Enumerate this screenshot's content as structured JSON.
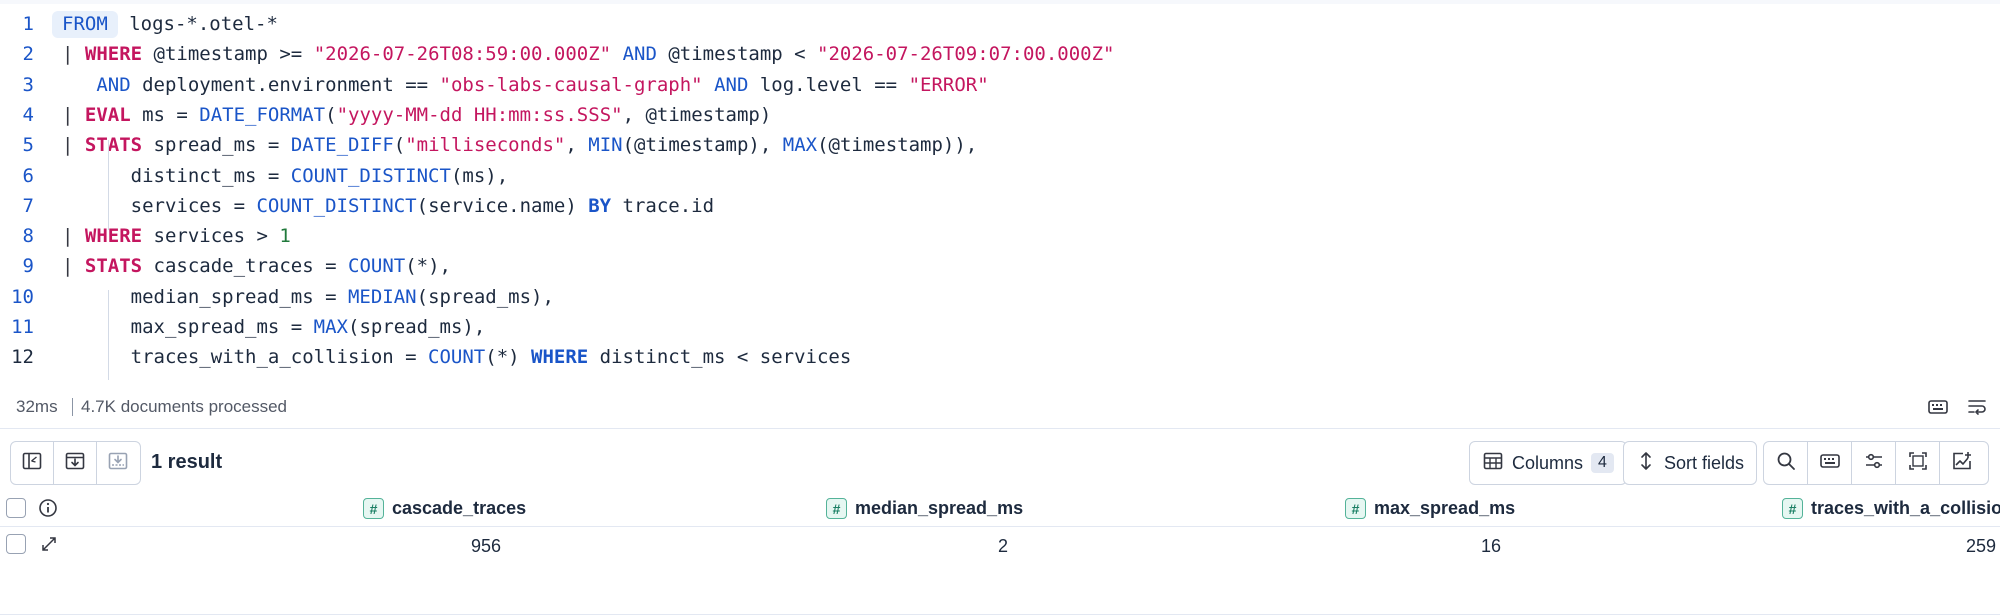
{
  "editor": {
    "lines": [
      {
        "n": "1",
        "tokens": [
          {
            "t": "FROM",
            "c": "from-chip"
          },
          {
            "t": " logs-*.otel-*",
            "c": ""
          }
        ]
      },
      {
        "n": "2",
        "tokens": [
          {
            "t": "| ",
            "c": "pipe"
          },
          {
            "t": "WHERE",
            "c": "kw-cmd"
          },
          {
            "t": " @timestamp >= ",
            "c": ""
          },
          {
            "t": "\"2026-07-26T08:59:00.000Z\"",
            "c": "str"
          },
          {
            "t": " ",
            "c": ""
          },
          {
            "t": "AND",
            "c": "kw-op"
          },
          {
            "t": " @timestamp < ",
            "c": ""
          },
          {
            "t": "\"2026-07-26T09:07:00.000Z\"",
            "c": "str"
          }
        ]
      },
      {
        "n": "3",
        "tokens": [
          {
            "t": "   ",
            "c": ""
          },
          {
            "t": "AND",
            "c": "kw-op"
          },
          {
            "t": " deployment.environment == ",
            "c": ""
          },
          {
            "t": "\"obs-labs-causal-graph\"",
            "c": "str"
          },
          {
            "t": " ",
            "c": ""
          },
          {
            "t": "AND",
            "c": "kw-op"
          },
          {
            "t": " log.level == ",
            "c": ""
          },
          {
            "t": "\"ERROR\"",
            "c": "str"
          }
        ]
      },
      {
        "n": "4",
        "tokens": [
          {
            "t": "| ",
            "c": "pipe"
          },
          {
            "t": "EVAL",
            "c": "kw-cmd"
          },
          {
            "t": " ms = ",
            "c": ""
          },
          {
            "t": "DATE_FORMAT",
            "c": "fn"
          },
          {
            "t": "(",
            "c": ""
          },
          {
            "t": "\"yyyy-MM-dd HH:mm:ss.SSS\"",
            "c": "str"
          },
          {
            "t": ", @timestamp)",
            "c": ""
          }
        ]
      },
      {
        "n": "5",
        "tokens": [
          {
            "t": "| ",
            "c": "pipe"
          },
          {
            "t": "STATS",
            "c": "kw-cmd"
          },
          {
            "t": " spread_ms = ",
            "c": ""
          },
          {
            "t": "DATE_DIFF",
            "c": "fn"
          },
          {
            "t": "(",
            "c": ""
          },
          {
            "t": "\"milliseconds\"",
            "c": "str"
          },
          {
            "t": ", ",
            "c": ""
          },
          {
            "t": "MIN",
            "c": "fn"
          },
          {
            "t": "(@timestamp), ",
            "c": ""
          },
          {
            "t": "MAX",
            "c": "fn"
          },
          {
            "t": "(@timestamp)),",
            "c": ""
          }
        ]
      },
      {
        "n": "6",
        "tokens": [
          {
            "t": "      distinct_ms = ",
            "c": ""
          },
          {
            "t": "COUNT_DISTINCT",
            "c": "fn"
          },
          {
            "t": "(ms),",
            "c": ""
          }
        ]
      },
      {
        "n": "7",
        "tokens": [
          {
            "t": "      services = ",
            "c": ""
          },
          {
            "t": "COUNT_DISTINCT",
            "c": "fn"
          },
          {
            "t": "(service.name) ",
            "c": ""
          },
          {
            "t": "BY",
            "c": "kw-by"
          },
          {
            "t": " trace.id",
            "c": ""
          }
        ]
      },
      {
        "n": "8",
        "tokens": [
          {
            "t": "| ",
            "c": "pipe"
          },
          {
            "t": "WHERE",
            "c": "kw-cmd"
          },
          {
            "t": " services > ",
            "c": ""
          },
          {
            "t": "1",
            "c": "num"
          }
        ]
      },
      {
        "n": "9",
        "tokens": [
          {
            "t": "| ",
            "c": "pipe"
          },
          {
            "t": "STATS",
            "c": "kw-cmd"
          },
          {
            "t": " cascade_traces = ",
            "c": ""
          },
          {
            "t": "COUNT",
            "c": "fn"
          },
          {
            "t": "(*),",
            "c": ""
          }
        ]
      },
      {
        "n": "10",
        "tokens": [
          {
            "t": "      median_spread_ms = ",
            "c": ""
          },
          {
            "t": "MEDIAN",
            "c": "fn"
          },
          {
            "t": "(spread_ms),",
            "c": ""
          }
        ]
      },
      {
        "n": "11",
        "tokens": [
          {
            "t": "      max_spread_ms = ",
            "c": ""
          },
          {
            "t": "MAX",
            "c": "fn"
          },
          {
            "t": "(spread_ms),",
            "c": ""
          }
        ]
      },
      {
        "n": "12",
        "tokens": [
          {
            "t": "      traces_with_a_collision = ",
            "c": ""
          },
          {
            "t": "COUNT",
            "c": "fn"
          },
          {
            "t": "(*) ",
            "c": ""
          },
          {
            "t": "WHERE",
            "c": "kw-by"
          },
          {
            "t": " distinct_ms < services",
            "c": ""
          }
        ]
      }
    ]
  },
  "status": {
    "time": "32ms",
    "docs": "4.7K documents processed",
    "icons": [
      "keyboard-icon",
      "wrap-lines-icon"
    ]
  },
  "toolbar": {
    "left_icons": [
      "table-view-icon",
      "document-view-icon",
      "download-icon"
    ],
    "result_count": "1 result",
    "columns_label": "Columns",
    "columns_count": "4",
    "sort_label": "Sort fields",
    "right_icons": [
      "search-icon",
      "keyboard-shortcuts-icon",
      "display-settings-icon",
      "fullscreen-icon",
      "add-visualization-icon"
    ]
  },
  "grid": {
    "columns": [
      "cascade_traces",
      "median_spread_ms",
      "max_spread_ms",
      "traces_with_a_collision"
    ],
    "rows": [
      [
        "956",
        "2",
        "16",
        "259"
      ]
    ]
  },
  "colors": {
    "command": "#c4165f",
    "function": "#1a55c8",
    "string": "#c4165f",
    "number": "#217a3c",
    "type_badge": "#54b399"
  }
}
